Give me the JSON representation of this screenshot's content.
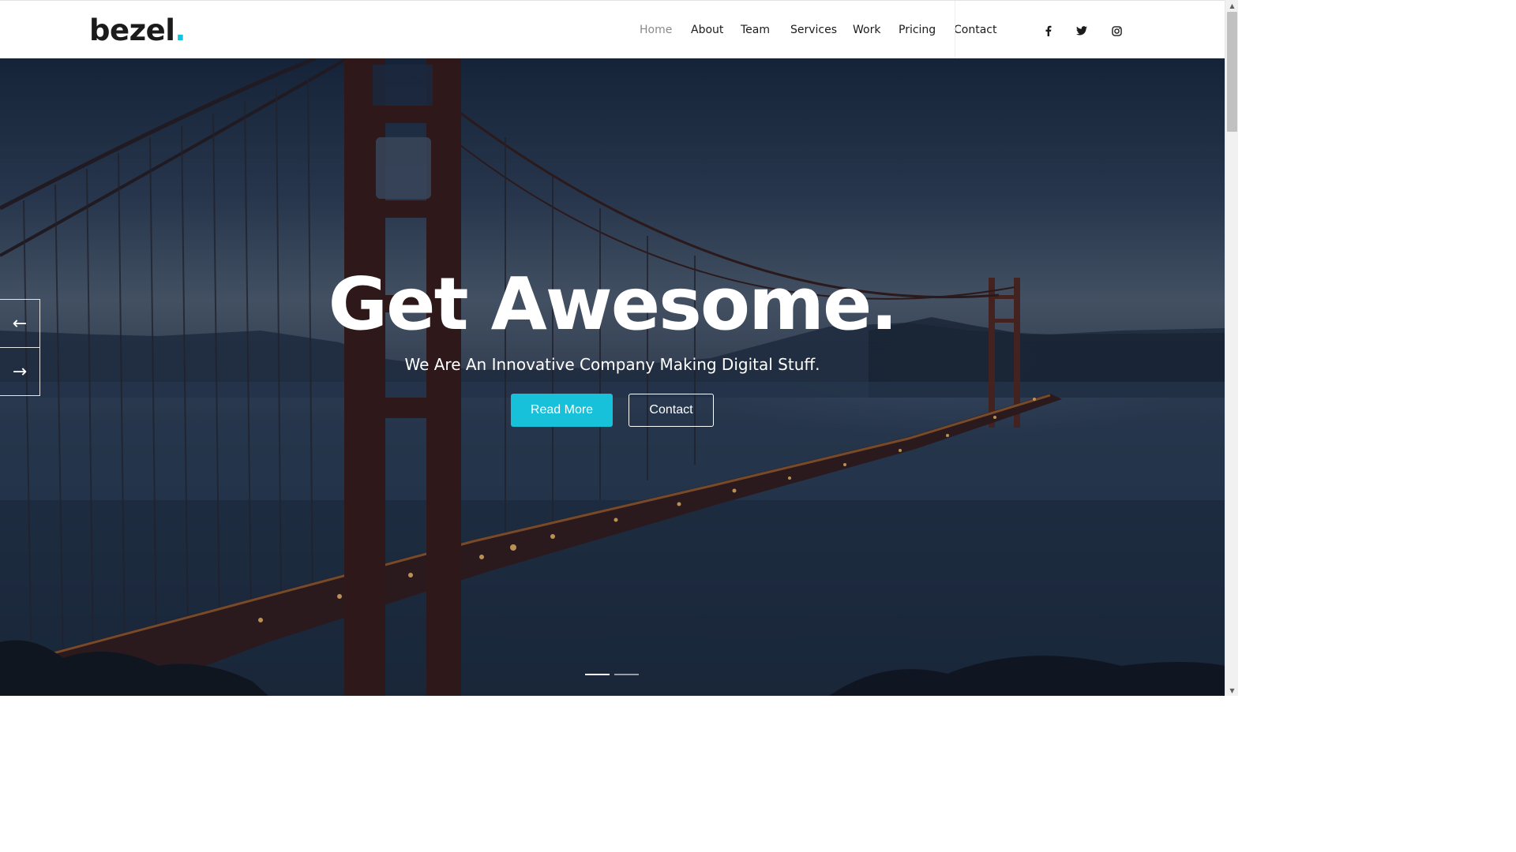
{
  "header": {
    "logo_text": "bezel",
    "logo_dot": ".",
    "nav": [
      "Home",
      "About",
      "Team",
      "Services",
      "Work",
      "Pricing",
      "Contact"
    ],
    "social_icons": [
      "facebook-icon",
      "twitter-icon",
      "instagram-icon"
    ]
  },
  "hero": {
    "title": "Get Awesome.",
    "subtitle": "We Are An Innovative Company Making Digital Stuff.",
    "primary_button": "Read More",
    "secondary_button": "Contact",
    "slide_count": 2,
    "active_slide": 1
  },
  "colors": {
    "accent": "#16c1d9",
    "text_dark": "#1b1b1b",
    "nav_active": "#8a8a8a"
  }
}
